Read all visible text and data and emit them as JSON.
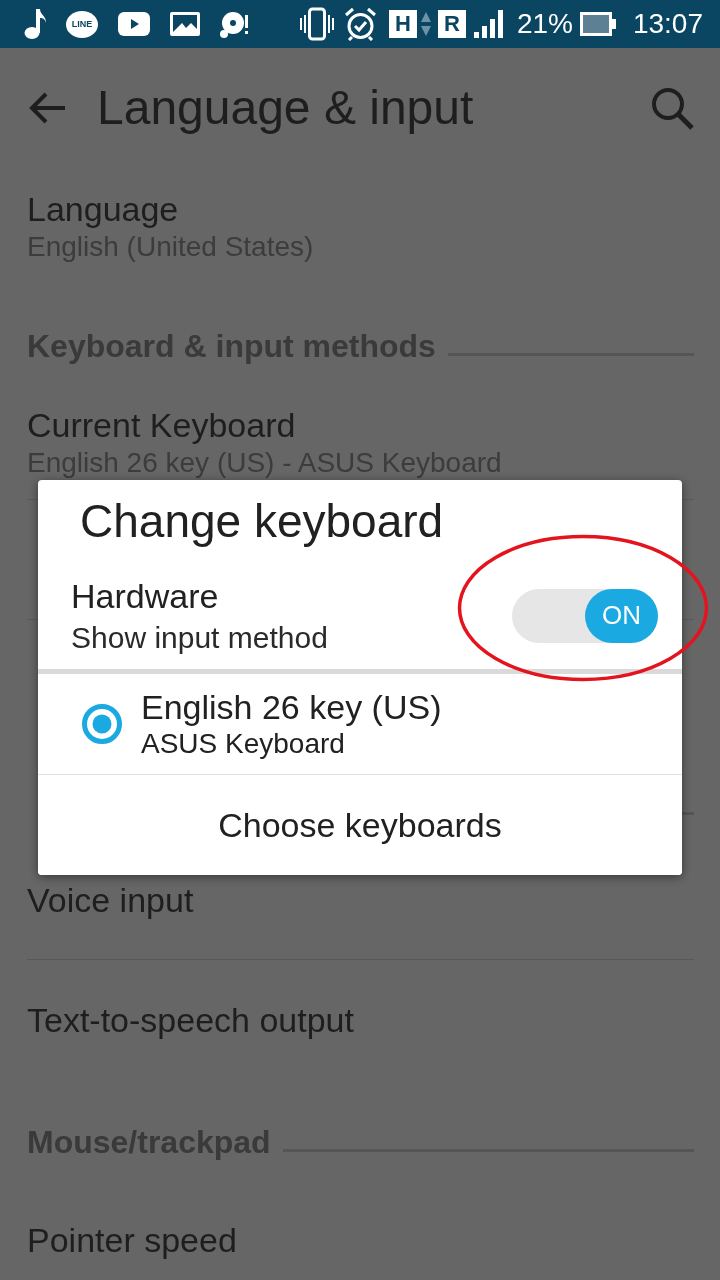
{
  "status_bar": {
    "chat_icon_text": "LINE",
    "network_type": "H",
    "roaming_indicator": "R",
    "battery_percent": "21%",
    "time": "13:07"
  },
  "app_bar": {
    "title": "Language & input"
  },
  "settings_top": [
    {
      "kind": "item",
      "title": "Language",
      "summary": "English (United States)"
    },
    {
      "kind": "header",
      "title": "Keyboard & input methods"
    },
    {
      "kind": "item",
      "title": "Current Keyboard",
      "summary": "English 26 key (US) - ASUS Keyboard"
    }
  ],
  "dialog": {
    "title": "Change keyboard",
    "hardware": {
      "title": "Hardware",
      "summary": "Show input method",
      "on": true,
      "switch_label": "ON",
      "annotated": true
    },
    "keyboards": [
      {
        "name": "English 26 key (US)",
        "provider": "ASUS Keyboard",
        "selected": true
      }
    ],
    "button": "Choose keyboards"
  },
  "settings_bottom": [
    {
      "kind": "item",
      "title": "Voice input"
    },
    {
      "kind": "item",
      "title": "Text-to-speech output"
    },
    {
      "kind": "header",
      "title": "Mouse/trackpad"
    },
    {
      "kind": "item",
      "title": "Pointer speed"
    }
  ]
}
